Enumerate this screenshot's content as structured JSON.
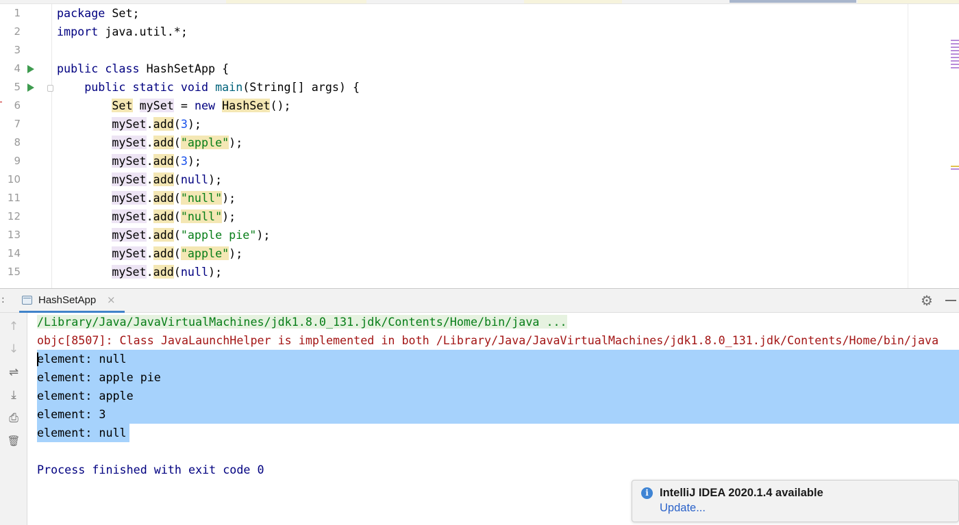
{
  "editor": {
    "line_numbers": [
      "1",
      "2",
      "3",
      "4",
      "5",
      "6",
      "7",
      "8",
      "9",
      "10",
      "11",
      "12",
      "13",
      "14",
      "15"
    ],
    "code": {
      "l1_kw": "package",
      "l1_rest": " Set;",
      "l2_kw": "import",
      "l2_rest": " java.util.*;",
      "l4_kw": "public class",
      "l4_rest": " HashSetApp {",
      "l5_kw": "public static void",
      "l5_fn": "main",
      "l5_rest": "(String[] args) {",
      "l6_type": "Set",
      "l6_var": "mySet",
      "l6_eq": " = ",
      "l6_kw": "new",
      "l6_cls": "HashSet",
      "l6_rest": "();",
      "obj": "mySet",
      "dot": ".",
      "add": "add",
      "open": "(",
      "close": ");",
      "l7_arg": "3",
      "l8_arg": "\"apple\"",
      "l9_arg": "3",
      "l10_arg": "null",
      "l11_arg": "\"null\"",
      "l12_arg": "\"null\"",
      "l13_arg": "\"apple pie\"",
      "l14_arg": "\"apple\"",
      "l15_arg": "null"
    }
  },
  "run_panel": {
    "colon": ":",
    "tab_label": "HashSetApp",
    "tab_close": "×",
    "settings_icon": "⚙",
    "toolbar": {
      "up": "↑",
      "down": "↓",
      "wrap": "⇌",
      "scroll_end": "⤓",
      "print": "⎙",
      "trash": "🗑"
    }
  },
  "console": {
    "cmd_line": "/Library/Java/JavaVirtualMachines/jdk1.8.0_131.jdk/Contents/Home/bin/java ...",
    "err_line": "objc[8507]: Class JavaLaunchHelper is implemented in both /Library/Java/JavaVirtualMachines/jdk1.8.0_131.jdk/Contents/Home/bin/java",
    "output": [
      "element: null",
      "element: apple pie",
      "element: apple",
      "element: 3",
      "element: null"
    ],
    "exit_line": "Process finished with exit code 0"
  },
  "notification": {
    "icon": "i",
    "title": "IntelliJ IDEA 2020.1.4 available",
    "link": "Update..."
  },
  "colors": {
    "keyword": "#000080",
    "string": "#067d17",
    "number": "#1750eb",
    "selection": "#a6d2fc",
    "error_text": "#a31515",
    "run_icon": "#3e9b4f",
    "link": "#2a62c9"
  }
}
